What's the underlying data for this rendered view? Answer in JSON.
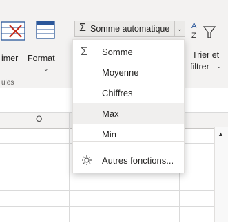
{
  "ribbon": {
    "format_button": "Format",
    "sort_label": "Trier et",
    "filter_label": "filtrer",
    "group_label_partial": "ules",
    "autosum_button": "Somme automatique",
    "delete_partial": "imer"
  },
  "dropdown": {
    "items": [
      {
        "label": "Somme",
        "icon": "sigma-icon"
      },
      {
        "label": "Moyenne"
      },
      {
        "label": "Chiffres"
      },
      {
        "label": "Max"
      },
      {
        "label": "Min"
      },
      {
        "label": "Autres fonctions...",
        "icon": "function-gear-icon"
      }
    ]
  },
  "sheet": {
    "column_o": "O"
  },
  "colors": {
    "ribbon_bg": "#f3f2f1",
    "highlight": "#f0efee",
    "accent_blue": "#2b579a"
  }
}
